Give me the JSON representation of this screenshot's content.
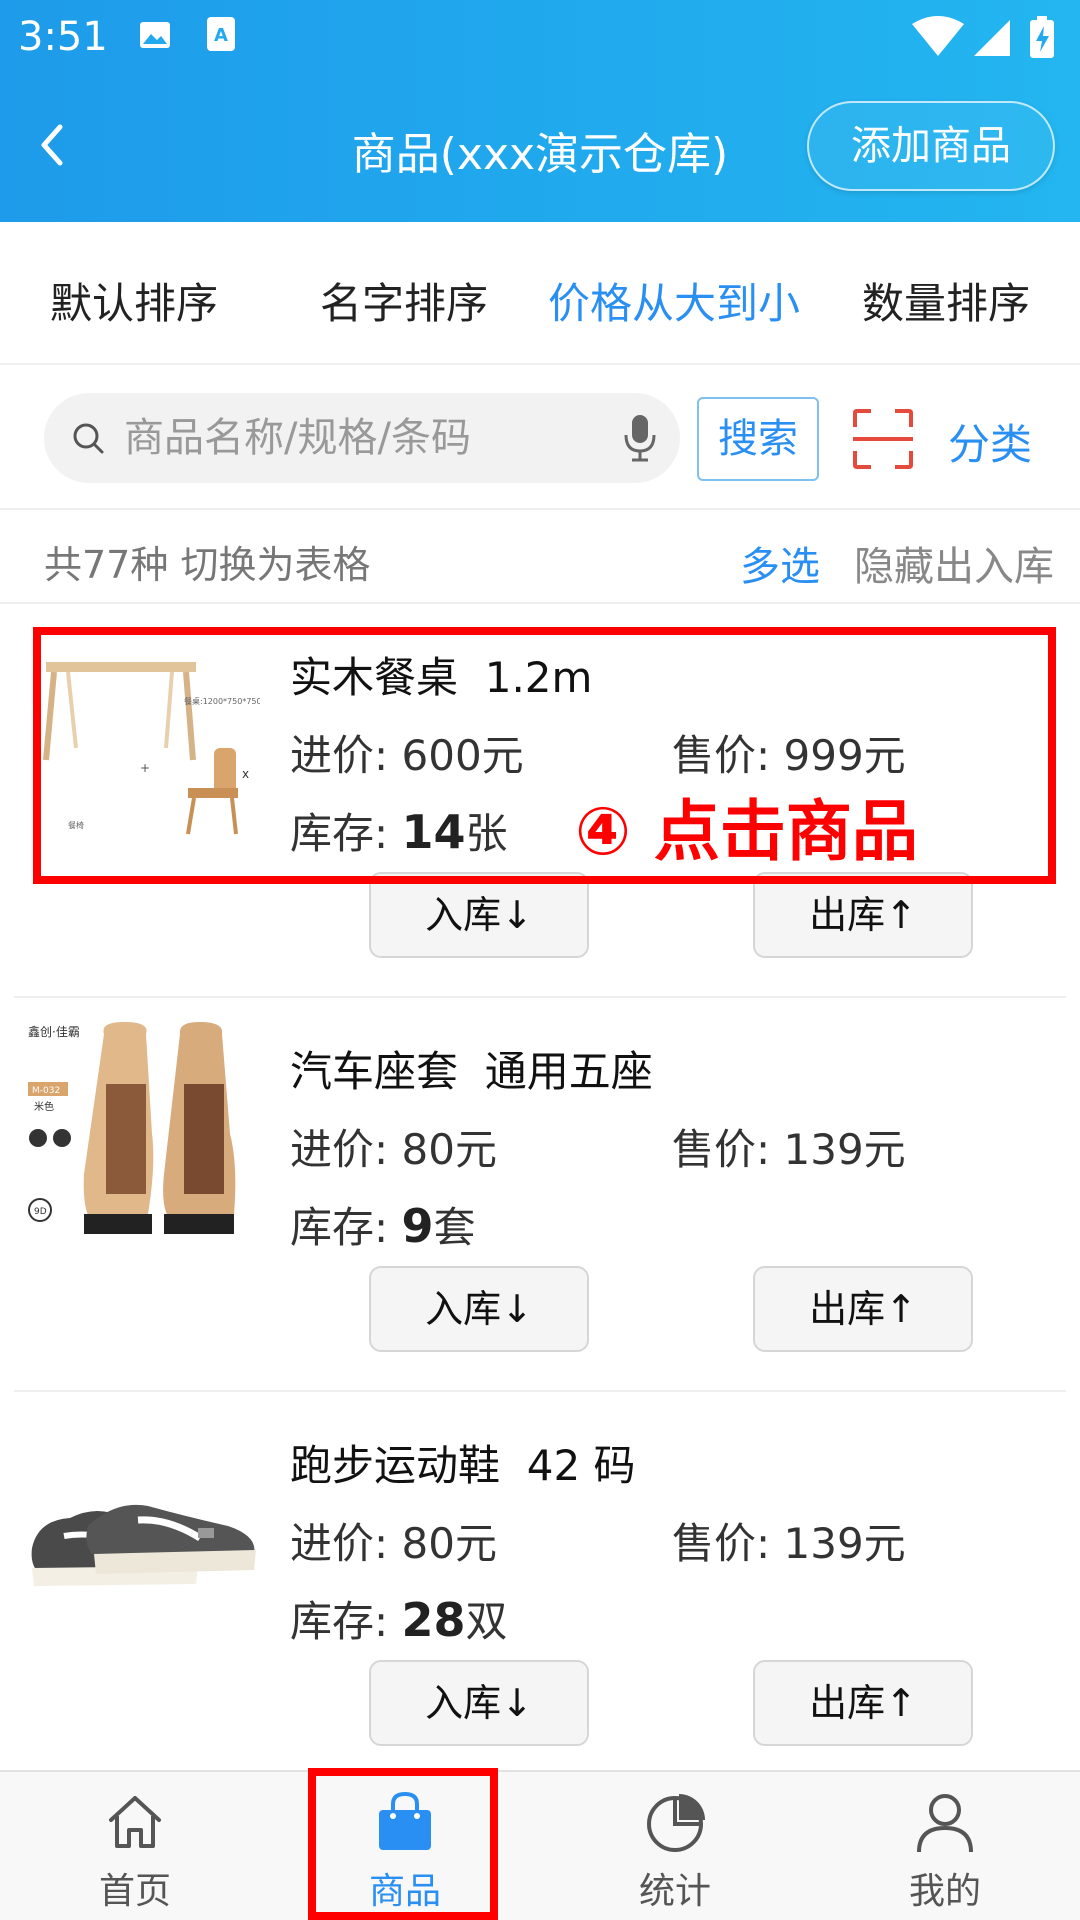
{
  "status_bar": {
    "time": "3:51"
  },
  "header": {
    "title": "商品(xxx演示仓库)",
    "add_button": "添加商品"
  },
  "sort_options": [
    "默认排序",
    "名字排序",
    "价格从大到小",
    "数量排序"
  ],
  "active_sort_index": 2,
  "search": {
    "placeholder": "商品名称/规格/条码",
    "value": "",
    "button": "搜索",
    "category": "分类"
  },
  "summary": {
    "count_text": "共77种",
    "switch_text": "切换为表格",
    "multi_select": "多选",
    "hide_io": "隐藏出入库"
  },
  "products": [
    {
      "name": "实木餐桌",
      "spec": "1.2m",
      "buy_label": "进价:",
      "buy_price": "600元",
      "sell_label": "售价:",
      "sell_price": "999元",
      "stock_label": "库存:",
      "stock_num": "14",
      "stock_unit": "张",
      "in_label": "入库↓",
      "out_label": "出库↑"
    },
    {
      "name": "汽车座套",
      "spec": "通用五座",
      "buy_label": "进价:",
      "buy_price": "80元",
      "sell_label": "售价:",
      "sell_price": "139元",
      "stock_label": "库存:",
      "stock_num": "9",
      "stock_unit": "套",
      "in_label": "入库↓",
      "out_label": "出库↑"
    },
    {
      "name": "跑步运动鞋",
      "spec": "42 码",
      "buy_label": "进价:",
      "buy_price": "80元",
      "sell_label": "售价:",
      "sell_price": "139元",
      "stock_label": "库存:",
      "stock_num": "28",
      "stock_unit": "双",
      "in_label": "入库↓",
      "out_label": "出库↑"
    }
  ],
  "annotation": {
    "text": "④ 点击商品",
    "color": "#ff0000"
  },
  "tabs": [
    {
      "label": "首页",
      "icon": "home-icon"
    },
    {
      "label": "商品",
      "icon": "shopping-bag-icon"
    },
    {
      "label": "统计",
      "icon": "pie-chart-icon"
    },
    {
      "label": "我的",
      "icon": "user-icon"
    }
  ],
  "active_tab_index": 1,
  "colors": {
    "accent": "#2a8ff2",
    "header": "#1e9bea",
    "highlight": "#ff0000"
  }
}
